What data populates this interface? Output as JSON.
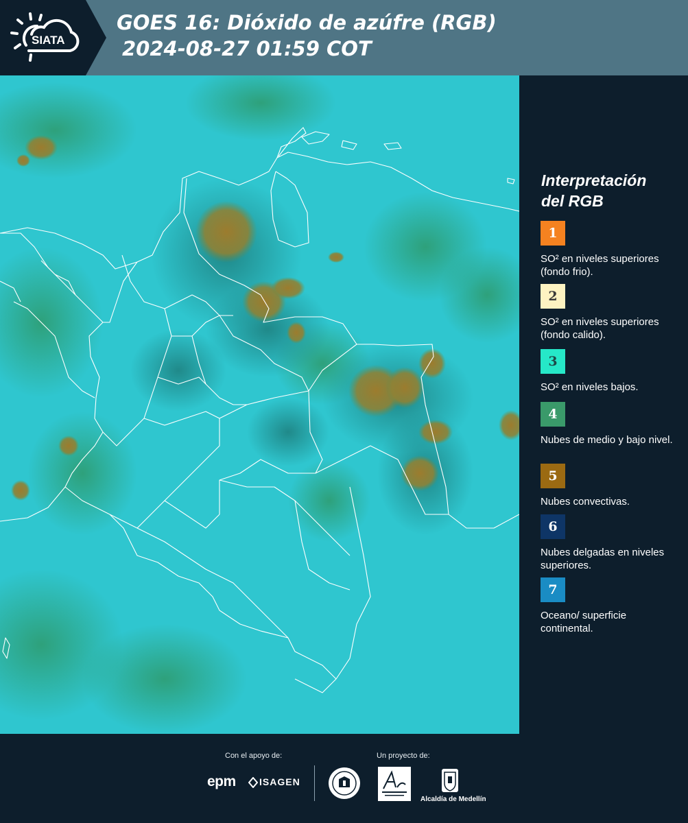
{
  "header": {
    "logo_text": "SIATA",
    "title_line1": "GOES 16: Dióxido de azúfre (RGB)",
    "title_line2": "2024-08-27 01:59 COT"
  },
  "map": {
    "background_color": "#2fc6cf",
    "border_color": "#ffffff",
    "convective_color": "#9c8334"
  },
  "legend": {
    "title_line1": "Interpretación",
    "title_line2": "del RGB",
    "items": [
      {
        "number": "1",
        "color": "#f58220",
        "number_color": "#ffffff",
        "text": "SO² en niveles superiores (fondo frio)."
      },
      {
        "number": "2",
        "color": "#fdf3c2",
        "number_color": "#3a3a3a",
        "text": "SO² en niveles superiores (fondo calido)."
      },
      {
        "number": "3",
        "color": "#26e8c8",
        "number_color": "#1d4a48",
        "text": "SO² en niveles bajos."
      },
      {
        "number": "4",
        "color": "#3a9a6a",
        "number_color": "#ffffff",
        "text": "Nubes de medio y bajo nivel."
      },
      {
        "number": "5",
        "color": "#9b6a12",
        "number_color": "#ffffff",
        "text": "Nubes convectivas."
      },
      {
        "number": "6",
        "color": "#0e3566",
        "number_color": "#ffffff",
        "text": "Nubes delgadas en niveles superiores."
      },
      {
        "number": "7",
        "color": "#1a8cc4",
        "number_color": "#ffffff",
        "text": "Oceano/ superficie continental."
      }
    ]
  },
  "footer": {
    "support_label": "Con el apoyo de:",
    "project_label": "Un proyecto de:",
    "epm_text": "epm",
    "isagen_text": "ISAGEN",
    "alcaldia_text": "Alcaldía de Medellín"
  }
}
